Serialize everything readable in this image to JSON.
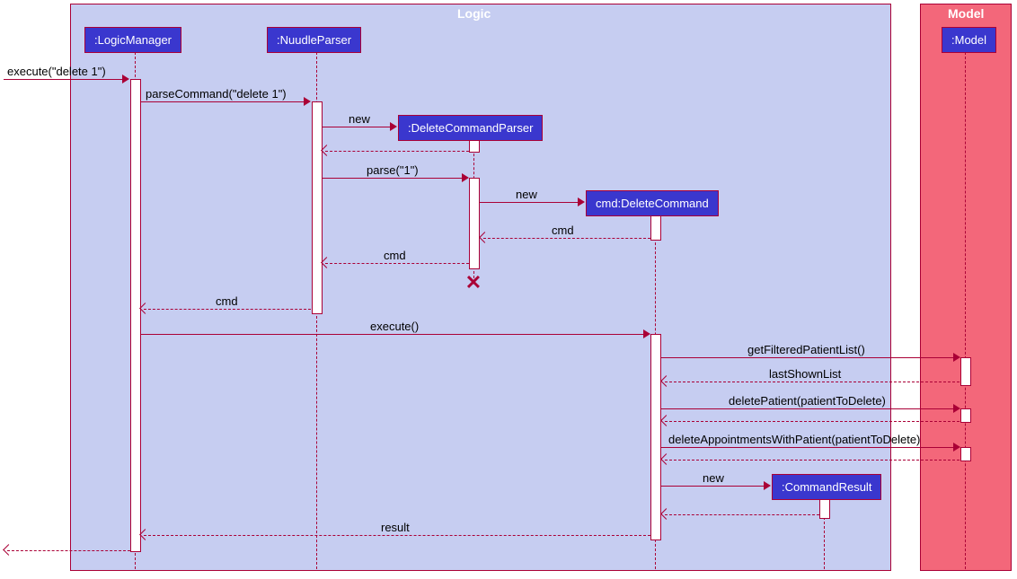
{
  "frames": {
    "logic": "Logic",
    "model": "Model"
  },
  "participants": {
    "logicManager": ":LogicManager",
    "nuudleParser": ":NuudleParser",
    "deleteCommandParser": ":DeleteCommandParser",
    "deleteCommand": "cmd:DeleteCommand",
    "commandResult": ":CommandResult",
    "model": ":Model"
  },
  "messages": {
    "execute": "execute(\"delete 1\")",
    "parseCommand": "parseCommand(\"delete 1\")",
    "new1": "new ",
    "parse": "parse(\"1\")",
    "new2": "new ",
    "cmd1": "cmd",
    "cmd2": "cmd",
    "cmd3": "cmd",
    "executeCall": "execute()",
    "getFilteredPatientList": "getFilteredPatientList()",
    "lastShownList": "lastShownList",
    "deletePatient": "deletePatient(patientToDelete)",
    "deleteAppts": "deleteAppointmentsWithPatient(patientToDelete)",
    "new3": "new ",
    "result": "result"
  },
  "chart_data": {
    "type": "sequence_diagram",
    "frames": [
      {
        "name": "Logic",
        "participants": [
          "LogicManager",
          "NuudleParser",
          "DeleteCommandParser",
          "DeleteCommand",
          "CommandResult"
        ]
      },
      {
        "name": "Model",
        "participants": [
          "Model"
        ]
      }
    ],
    "participants": [
      {
        "id": "LogicManager",
        "label": ":LogicManager"
      },
      {
        "id": "NuudleParser",
        "label": ":NuudleParser"
      },
      {
        "id": "DeleteCommandParser",
        "label": ":DeleteCommandParser",
        "created_by_message": 2,
        "destroyed_after_message": 7
      },
      {
        "id": "DeleteCommand",
        "label": "cmd:DeleteCommand",
        "created_by_message": 4
      },
      {
        "id": "CommandResult",
        "label": ":CommandResult",
        "created_by_message": 16
      },
      {
        "id": "Model",
        "label": ":Model"
      }
    ],
    "messages": [
      {
        "seq": 1,
        "from": "external",
        "to": "LogicManager",
        "label": "execute(\"delete 1\")",
        "type": "call"
      },
      {
        "seq": 2,
        "from": "LogicManager",
        "to": "NuudleParser",
        "label": "parseCommand(\"delete 1\")",
        "type": "call"
      },
      {
        "seq": 3,
        "from": "NuudleParser",
        "to": "DeleteCommandParser",
        "label": "new",
        "type": "create"
      },
      {
        "seq": 4,
        "from": "DeleteCommandParser",
        "to": "NuudleParser",
        "label": "",
        "type": "return"
      },
      {
        "seq": 5,
        "from": "NuudleParser",
        "to": "DeleteCommandParser",
        "label": "parse(\"1\")",
        "type": "call"
      },
      {
        "seq": 6,
        "from": "DeleteCommandParser",
        "to": "DeleteCommand",
        "label": "new",
        "type": "create"
      },
      {
        "seq": 7,
        "from": "DeleteCommand",
        "to": "DeleteCommandParser",
        "label": "cmd",
        "type": "return"
      },
      {
        "seq": 8,
        "from": "DeleteCommandParser",
        "to": "NuudleParser",
        "label": "cmd",
        "type": "return"
      },
      {
        "seq": 9,
        "from": "NuudleParser",
        "to": "LogicManager",
        "label": "cmd",
        "type": "return"
      },
      {
        "seq": 10,
        "from": "LogicManager",
        "to": "DeleteCommand",
        "label": "execute()",
        "type": "call"
      },
      {
        "seq": 11,
        "from": "DeleteCommand",
        "to": "Model",
        "label": "getFilteredPatientList()",
        "type": "call"
      },
      {
        "seq": 12,
        "from": "Model",
        "to": "DeleteCommand",
        "label": "lastShownList",
        "type": "return"
      },
      {
        "seq": 13,
        "from": "DeleteCommand",
        "to": "Model",
        "label": "deletePatient(patientToDelete)",
        "type": "call"
      },
      {
        "seq": 14,
        "from": "Model",
        "to": "DeleteCommand",
        "label": "",
        "type": "return"
      },
      {
        "seq": 15,
        "from": "DeleteCommand",
        "to": "Model",
        "label": "deleteAppointmentsWithPatient(patientToDelete)",
        "type": "call"
      },
      {
        "seq": 16,
        "from": "Model",
        "to": "DeleteCommand",
        "label": "",
        "type": "return"
      },
      {
        "seq": 17,
        "from": "DeleteCommand",
        "to": "CommandResult",
        "label": "new",
        "type": "create"
      },
      {
        "seq": 18,
        "from": "CommandResult",
        "to": "DeleteCommand",
        "label": "",
        "type": "return"
      },
      {
        "seq": 19,
        "from": "DeleteCommand",
        "to": "LogicManager",
        "label": "result",
        "type": "return"
      },
      {
        "seq": 20,
        "from": "LogicManager",
        "to": "external",
        "label": "",
        "type": "return"
      }
    ]
  }
}
